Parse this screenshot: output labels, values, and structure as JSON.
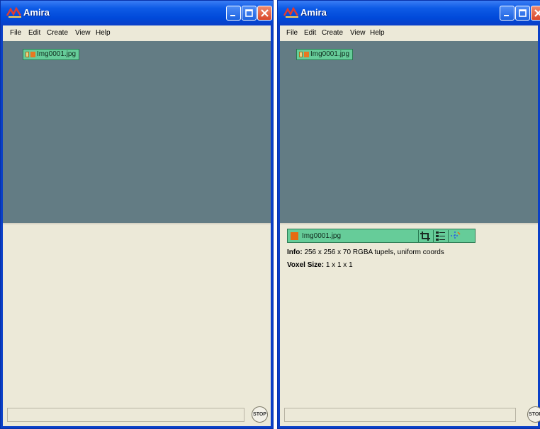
{
  "left_window": {
    "title": "Amira",
    "menu": [
      "File",
      "Edit",
      "Create",
      "View",
      "Help"
    ],
    "data_object": "Img0001.jpg",
    "stop_label": "STOP"
  },
  "right_window": {
    "title": "Amira",
    "menu": [
      "File",
      "Edit",
      "Create",
      "View",
      "Help"
    ],
    "data_object": "Img0001.jpg",
    "module_label": "Img0001.jpg",
    "info_label": "Info:",
    "info_value": "256 x 256 x 70 RGBA tupels, uniform coords",
    "voxel_label": "Voxel Size:",
    "voxel_value": "1 x 1 x 1",
    "stop_label": "STOP"
  },
  "colors": {
    "title_bar": "#0a4fd9",
    "pool_background": "#637c84",
    "node_green": "#66cc99",
    "panel_background": "#ece9d8"
  }
}
